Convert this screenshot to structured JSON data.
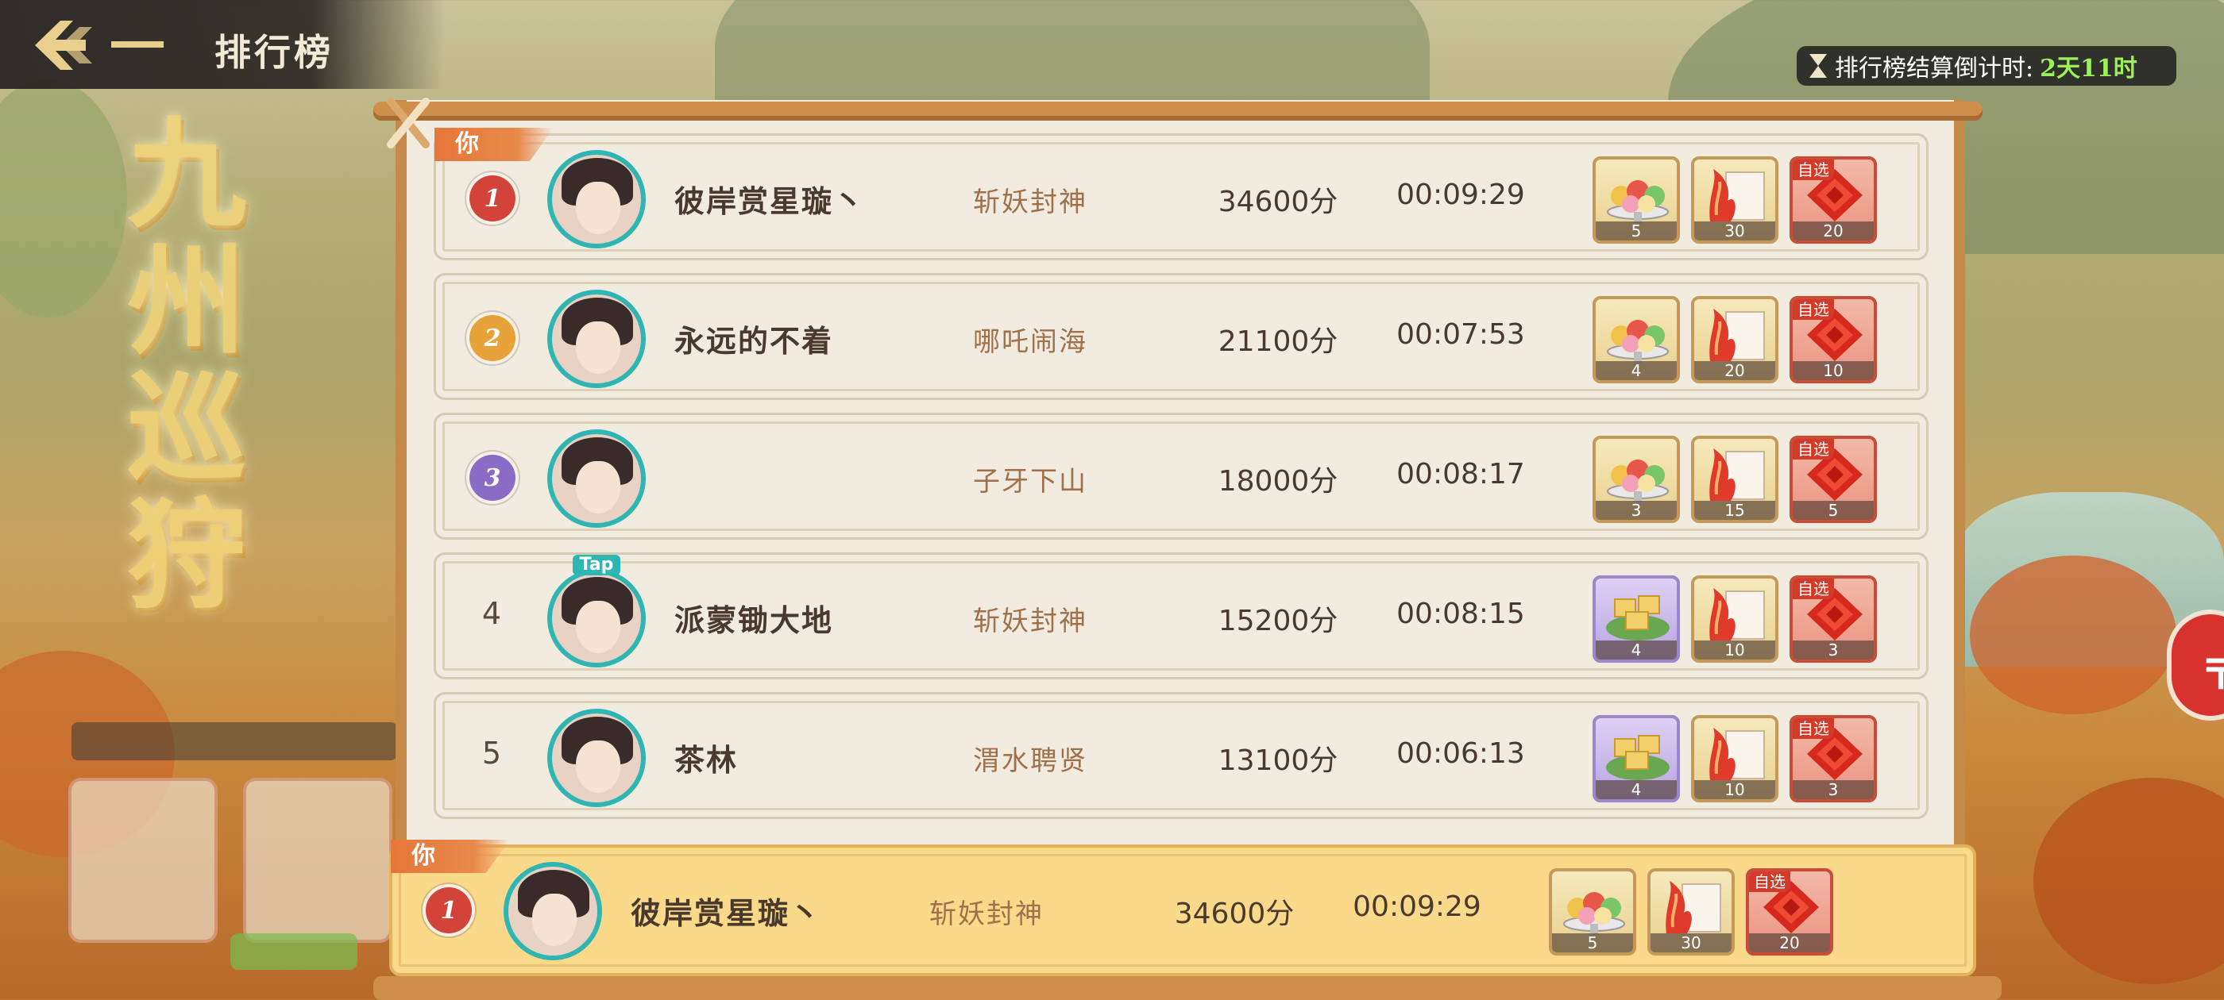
{
  "header": {
    "title": "排行榜",
    "countdown_label": "排行榜结算倒计时:",
    "countdown_value": "2天11时"
  },
  "banner_title": "九州巡狩",
  "you_label": "你",
  "pick_label": "自选",
  "rows": [
    {
      "rank": "1",
      "name": "彼岸赏星璇丶",
      "stage": "斩妖封神",
      "score": "34600分",
      "time": "00:09:29",
      "rewards": [
        {
          "icon": "cake-platter-icon",
          "qty": "5"
        },
        {
          "icon": "red-scroll-icon",
          "qty": "30"
        },
        {
          "icon": "red-gem-icon",
          "qty": "20"
        }
      ]
    },
    {
      "rank": "2",
      "name": "永远的不着",
      "stage": "哪吒闹海",
      "score": "21100分",
      "time": "00:07:53",
      "rewards": [
        {
          "icon": "cake-platter-icon",
          "qty": "4"
        },
        {
          "icon": "red-scroll-icon",
          "qty": "20"
        },
        {
          "icon": "red-gem-icon",
          "qty": "10"
        }
      ]
    },
    {
      "rank": "3",
      "name": "",
      "stage": "子牙下山",
      "score": "18000分",
      "time": "00:08:17",
      "rewards": [
        {
          "icon": "cake-platter-icon",
          "qty": "3"
        },
        {
          "icon": "red-scroll-icon",
          "qty": "15"
        },
        {
          "icon": "red-gem-icon",
          "qty": "5"
        }
      ]
    },
    {
      "rank": "4",
      "name": "派蒙锄大地",
      "stage": "斩妖封神",
      "score": "15200分",
      "time": "00:08:15",
      "avatar_tag": "Tap",
      "rewards": [
        {
          "icon": "pastry-leaf-icon",
          "qty": "4"
        },
        {
          "icon": "red-scroll-icon",
          "qty": "10"
        },
        {
          "icon": "red-gem-icon",
          "qty": "3"
        }
      ]
    },
    {
      "rank": "5",
      "name": "茶林",
      "stage": "渭水聘贤",
      "score": "13100分",
      "time": "00:06:13",
      "rewards": [
        {
          "icon": "pastry-leaf-icon",
          "qty": "4"
        },
        {
          "icon": "red-scroll-icon",
          "qty": "10"
        },
        {
          "icon": "red-gem-icon",
          "qty": "3"
        }
      ]
    }
  ],
  "my_row": {
    "rank": "1",
    "name": "彼岸赏星璇丶",
    "stage": "斩妖封神",
    "score": "34600分",
    "time": "00:09:29",
    "rewards": [
      {
        "icon": "cake-platter-icon",
        "qty": "5"
      },
      {
        "icon": "red-scroll-icon",
        "qty": "30"
      },
      {
        "icon": "red-gem-icon",
        "qty": "20"
      }
    ]
  },
  "colors": {
    "rank1": "#d2433a",
    "rank2": "#e8a23a",
    "rank3": "#8a6cc7",
    "countdown_value": "#9cf05a",
    "my_row_bg": "#fbd98a"
  }
}
